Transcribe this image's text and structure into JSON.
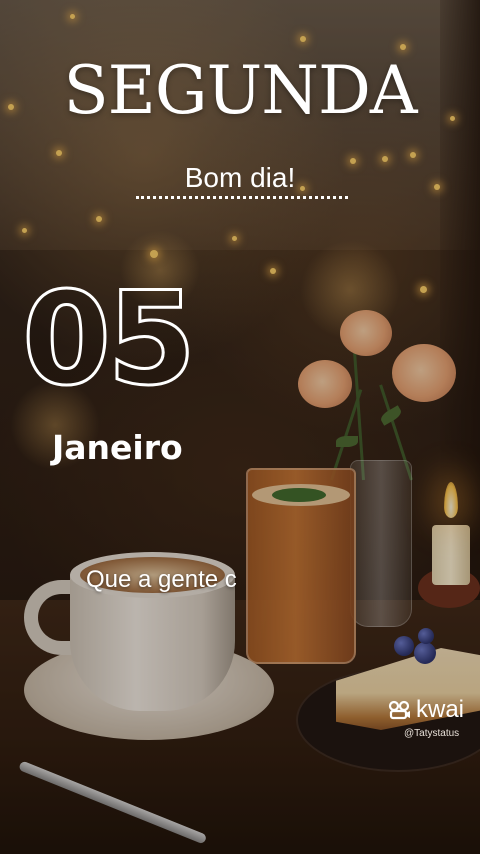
{
  "day_title": "SEGUNDA",
  "greeting": "Bom dia!",
  "day_number": "05",
  "month": "Janeiro",
  "phrase": "Que a gente c",
  "watermark": {
    "brand": "kwai",
    "handle": "@Tatystatus",
    "icon": "kwai-logo-icon"
  },
  "colors": {
    "text": "#ffffff",
    "background": "#2a1c12",
    "accent_light": "#ffd36a"
  }
}
